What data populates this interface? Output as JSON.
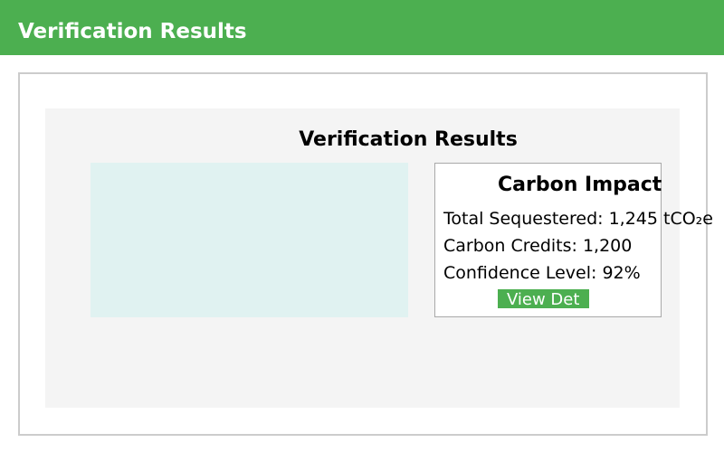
{
  "header": {
    "title": "Verification Results"
  },
  "main": {
    "panel_title": "Verification Results",
    "carbon_impact": {
      "title": "Carbon Impact",
      "total_sequestered": "Total Sequestered: 1,245 tCO₂e",
      "carbon_credits": "Carbon Credits: 1,200",
      "confidence_level": "Confidence Level: 92%",
      "button_label": "View Det"
    }
  },
  "colors": {
    "accent": "#4caf50",
    "panel_background": "#f4f4f4",
    "map_placeholder": "#e0f2f1",
    "card_border": "#cccccc"
  }
}
